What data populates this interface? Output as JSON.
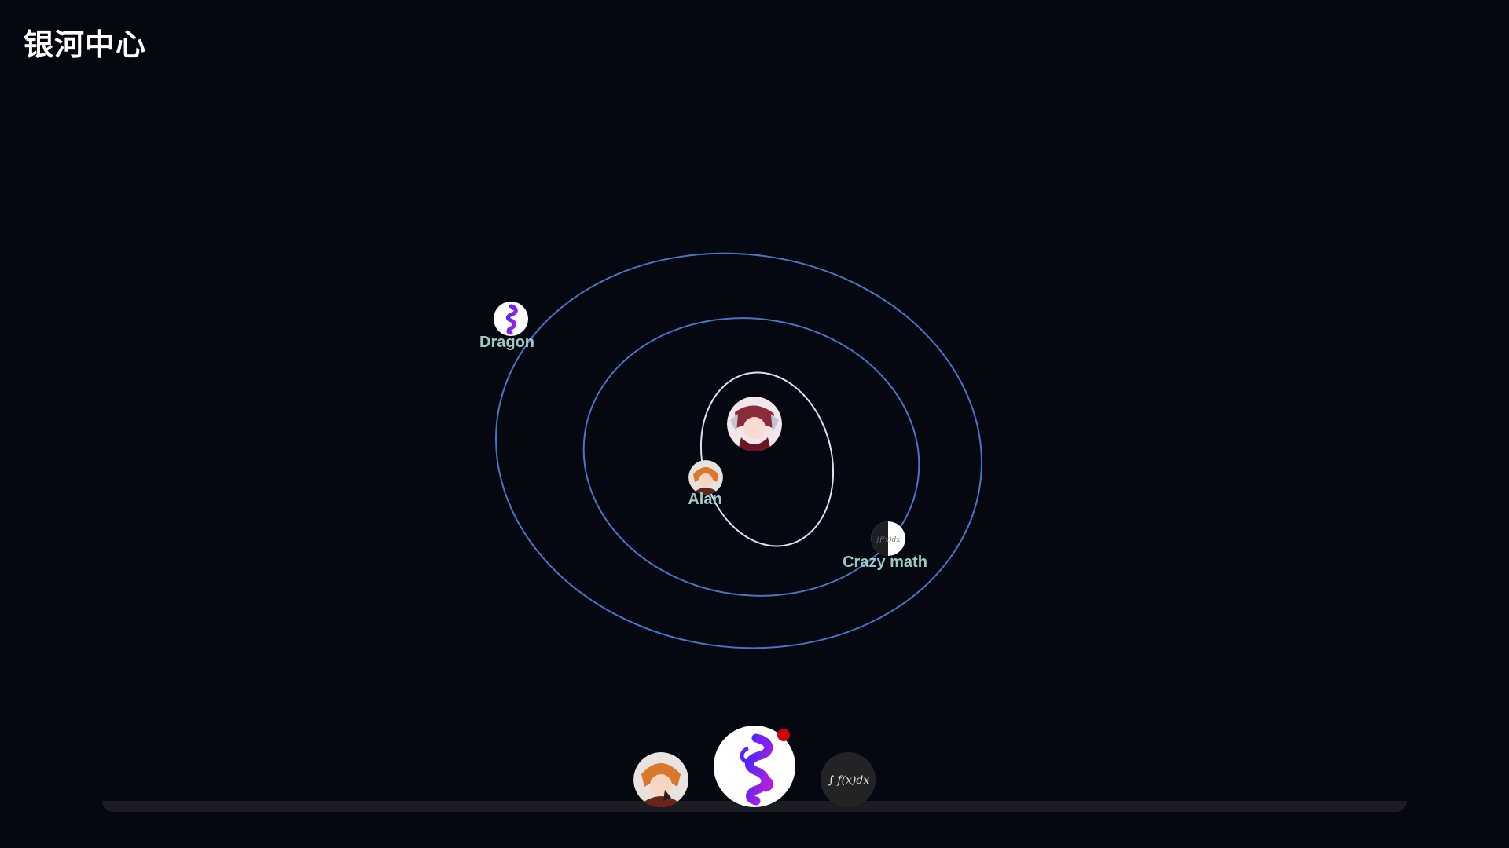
{
  "app": {
    "title": "银河中心"
  },
  "colors": {
    "background": "#050811",
    "outer_orbit": "#4d74c4",
    "inner_orbit": "#d8e4f4",
    "label": "#9fc9c4",
    "badge": "#d0020a",
    "dock_bar": "#1b1d22"
  },
  "center": {
    "avatar_icon": "anime-girl-avatar-icon"
  },
  "planets": [
    {
      "name": "Dragon",
      "icon": "purple-dragon-icon"
    },
    {
      "name": "Alan",
      "icon": "orange-hair-avatar-icon"
    },
    {
      "name": "Crazy math",
      "icon": "integral-formula-icon"
    }
  ],
  "formula_text": "∫ f(x)dx",
  "dock": {
    "items": [
      {
        "name": "Alan",
        "icon": "orange-hair-avatar-icon"
      },
      {
        "name": "Dragon",
        "icon": "purple-dragon-icon",
        "active": true,
        "notification": true
      },
      {
        "name": "Crazy math",
        "icon": "integral-formula-icon"
      }
    ]
  }
}
